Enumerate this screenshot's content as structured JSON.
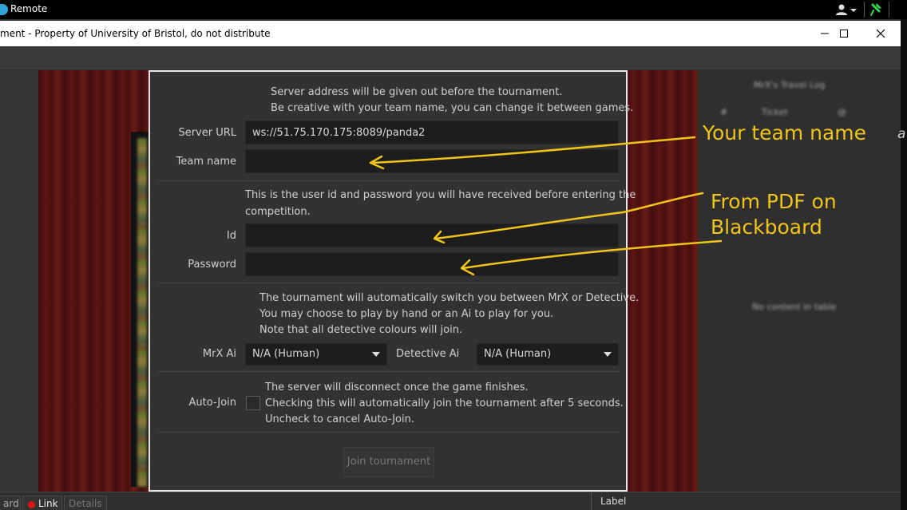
{
  "remote_bar": {
    "title": "Remote"
  },
  "window": {
    "title": "ment - Property of University of Bristol, do not distribute"
  },
  "dialog": {
    "server_info": [
      "Server address will be given out before the tournament.",
      "Be creative with your team name, you can change it between games."
    ],
    "server_url_label": "Server URL",
    "server_url_value": "ws://51.75.170.175:8089/panda2",
    "team_name_label": "Team name",
    "team_name_value": "",
    "credentials_info": [
      "This is the user id and password you will have received before entering the",
      "competition."
    ],
    "id_label": "Id",
    "id_value": "",
    "password_label": "Password",
    "password_value": "",
    "ai_info": [
      "The tournament will automatically switch you between MrX or Detective.",
      "You may choose to play by hand or an Ai to play for you.",
      "Note that all detective colours will join."
    ],
    "mrx_ai_label": "MrX Ai",
    "mrx_ai_value": "N/A (Human)",
    "detective_ai_label": "Detective Ai",
    "detective_ai_value": "N/A (Human)",
    "auto_join_label": "Auto-Join",
    "auto_join_checked": false,
    "auto_join_info": [
      "The server will disconnect once the game finishes.",
      "Checking this will automatically join the tournament after 5 seconds.",
      "Uncheck to cancel Auto-Join."
    ],
    "join_button_label": "Join tournament"
  },
  "right_panel": {
    "title": "MrX's Travel Log",
    "columns": [
      "#",
      "Ticket",
      "@"
    ],
    "empty_text": "No content in table",
    "edge_glyph": "a"
  },
  "status_bar": {
    "left_fragment": "ard",
    "link_label": "Link",
    "details_label": "Details",
    "right_label": "Label"
  },
  "annotations": {
    "team_name_note": "Your team name",
    "credentials_note_line1": "From PDF on",
    "credentials_note_line2": "Blackboard",
    "color": "#f0c419"
  },
  "colors": {
    "dialog_bg": "#323232",
    "board_wood": "#5a1512",
    "link_dot": "#e01414"
  }
}
